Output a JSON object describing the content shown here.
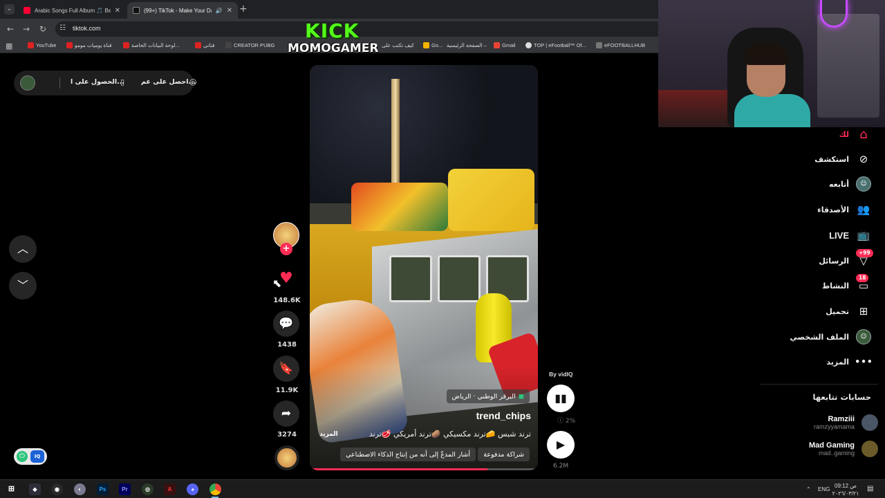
{
  "browser": {
    "tabs": [
      {
        "title": "Arabic Songs Full Album 🎵 Be",
        "favicon_color": "#ff0033",
        "active": false
      },
      {
        "title": "(99+) TikTok - Make Your Day",
        "favicon_color": "#111111",
        "active": true
      }
    ],
    "url": "tiktok.com",
    "bookmarks": [
      {
        "label": "YouTube"
      },
      {
        "label": "قناة يوميات مومو"
      },
      {
        "label": "لوحة البيانات الخاصة..."
      },
      {
        "label": "قناتي"
      },
      {
        "label": "CREATOR PUBG"
      },
      {
        "label": "كيف تكتب على"
      },
      {
        "label": "Go..."
      },
      {
        "label": "الصفحة الرئيسية –"
      },
      {
        "label": "Gmail"
      },
      {
        "label": "TOP | eFootball™ Of..."
      },
      {
        "label": "eFOOTBALLHUB"
      }
    ]
  },
  "overlay": {
    "kick": "KICK",
    "channel": "MOMOGAMER"
  },
  "top_pill": {
    "item1": "الحصول على ا...",
    "item2": "احصل على عم..."
  },
  "video": {
    "location": "البرقر الوطني · الرياض",
    "author": "trend_chips",
    "caption": "ترند شبس 🧀ترند مكسيكي 🥔ترند أمريكي 🥩ترند",
    "more": "المزيد",
    "tags": [
      "شراكة مدفوعة",
      "أشار المدعّ إلى أنه من إنتاج الذكاء الاصطناعي"
    ],
    "progress": 0.78
  },
  "actions": {
    "likes": "148.6K",
    "comments": "1438",
    "saves": "11.9K",
    "shares": "3274"
  },
  "vidiq": {
    "by": "By vidIQ",
    "percent": "2%",
    "views": "6.2M"
  },
  "sidebar": {
    "items": [
      {
        "label": "لك",
        "icon": "home-icon",
        "active": true
      },
      {
        "label": "استكشف",
        "icon": "compass-icon"
      },
      {
        "label": "أتابعه",
        "icon": "avatar-icon"
      },
      {
        "label": "الأصدقاء",
        "icon": "friends-icon"
      },
      {
        "label": "LIVE",
        "icon": "live-icon"
      },
      {
        "label": "الرسائل",
        "icon": "messages-icon",
        "badge": "+99"
      },
      {
        "label": "النشاط",
        "icon": "activity-icon",
        "badge": "18"
      },
      {
        "label": "تحميل",
        "icon": "upload-icon"
      },
      {
        "label": "الملف الشخصي",
        "icon": "profile-icon"
      },
      {
        "label": "المزيد",
        "icon": "more-icon"
      }
    ],
    "following_header": "حسابات تتابعها",
    "following": [
      {
        "name": "Ramziii",
        "handle": "ramzyyamama"
      },
      {
        "name": "Mad Gaming",
        "handle": "mad..gaming"
      }
    ]
  },
  "taskbar": {
    "apps": [
      "Ps",
      "Pr"
    ],
    "lang": "ENG",
    "time": "09:12 ص",
    "date": "٢٠٢٦/٠٣/٢١"
  },
  "colors": {
    "accent": "#fe2c55",
    "kick": "#53fc18"
  }
}
